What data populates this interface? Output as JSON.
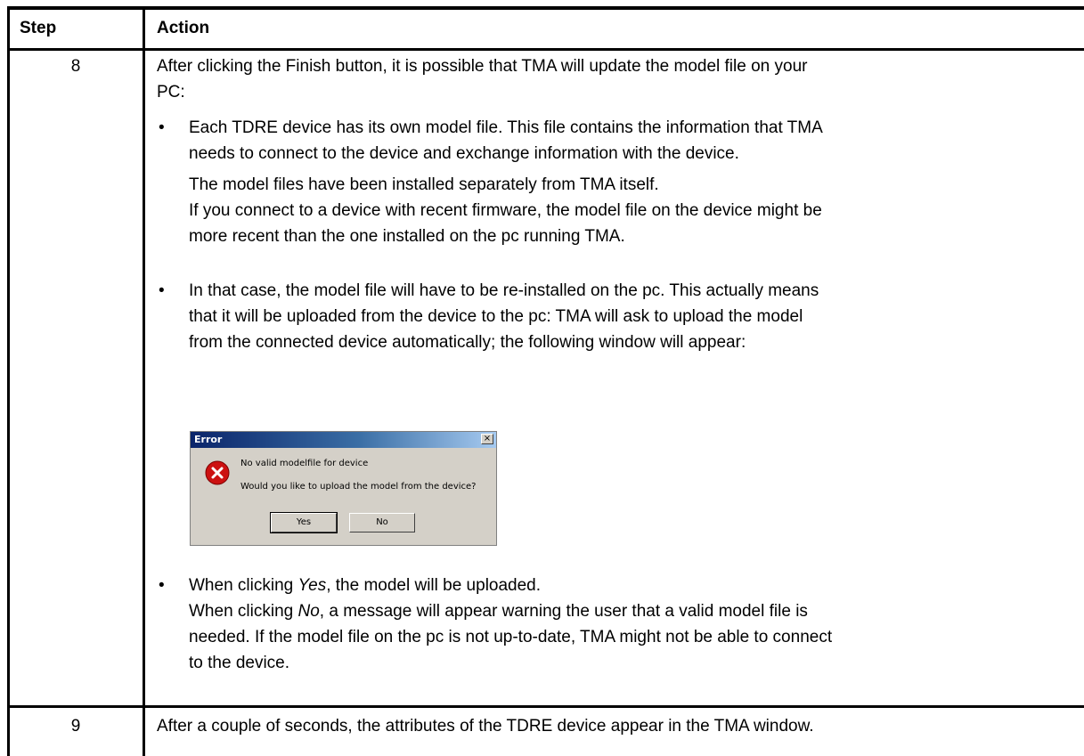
{
  "table": {
    "header": {
      "step": "Step",
      "action": "Action"
    },
    "rows": [
      {
        "step": "8",
        "intro_line1": "After clicking the Finish button, it is possible that TMA will update the model file on your",
        "intro_line2": "PC:",
        "bullets": [
          {
            "lines": [
              "Each TDRE device has its own model file. This file contains the information that TMA",
              "needs to connect to the device and exchange information with the device."
            ],
            "extra": [
              "The model files have been installed separately from TMA itself.",
              "If you connect to a device with recent firmware, the model file on the device might be",
              "more recent than the one installed on the pc running TMA."
            ]
          },
          {
            "lines": [
              "In that case, the model file will have to be re-installed on the pc. This actually means",
              "that it will be uploaded from the device to the pc: TMA will ask to upload the model",
              "from the connected device automatically; the following window will appear:"
            ]
          },
          {
            "line1_pre": "When clicking ",
            "line1_em": "Yes",
            "line1_post": ", the model will be uploaded.",
            "line2_pre": "When clicking ",
            "line2_em": "No",
            "line2_post": ", a message will appear warning the user that a valid model file is",
            "line3": "needed. If the model file on the pc is not up-to-date, TMA might not be able to connect",
            "line4": "to the device."
          }
        ]
      },
      {
        "step": "9",
        "text": "After a couple of seconds, the attributes of the TDRE device appear in the TMA window."
      }
    ]
  },
  "dialog": {
    "title": "Error",
    "close_glyph": "×",
    "message1": "No valid modelfile for device",
    "message2": "Would you like to upload the model from the device?",
    "yes_label": "Yes",
    "no_label": "No",
    "icon": "error-icon",
    "icon_color": "#cc1111"
  },
  "bullet_glyph": "•"
}
